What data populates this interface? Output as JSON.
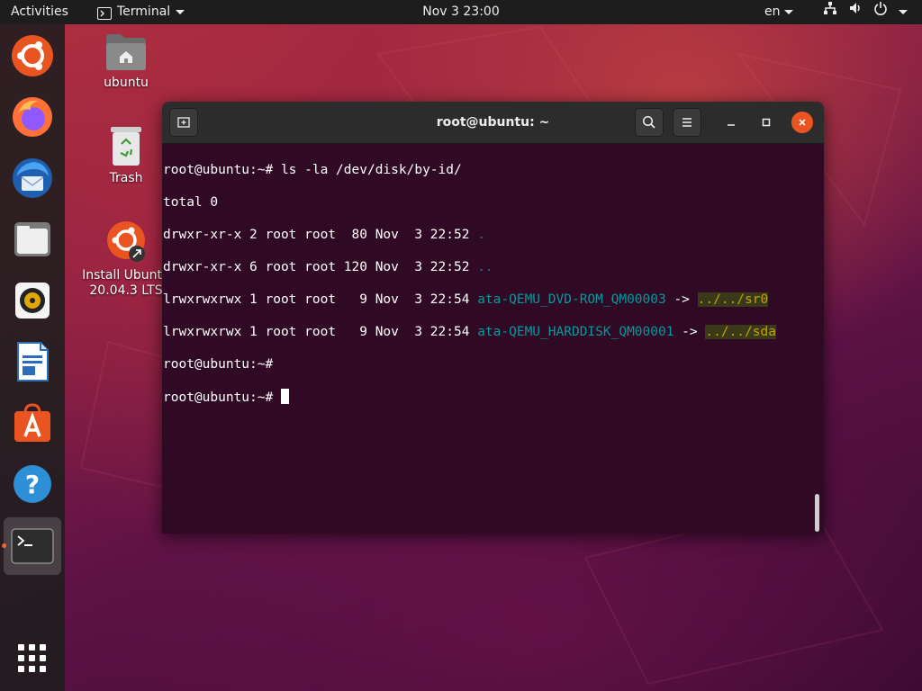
{
  "topbar": {
    "activities": "Activities",
    "app_name": "Terminal",
    "clock": "Nov 3  23:00",
    "language": "en"
  },
  "dock": {
    "items": [
      {
        "name": "Install Ubuntu"
      },
      {
        "name": "Firefox"
      },
      {
        "name": "Thunderbird"
      },
      {
        "name": "Files"
      },
      {
        "name": "Rhythmbox"
      },
      {
        "name": "LibreOffice Writer"
      },
      {
        "name": "Ubuntu Software"
      },
      {
        "name": "Help"
      },
      {
        "name": "Terminal"
      },
      {
        "name": "Show Applications"
      }
    ]
  },
  "desktop": {
    "home_label": "ubuntu",
    "trash_label": "Trash",
    "installer_label_line1": "Install Ubuntu",
    "installer_label_line2": "20.04.3 LTS"
  },
  "terminal": {
    "title": "root@ubuntu: ~",
    "lines": {
      "cmd": "root@ubuntu:~# ls -la /dev/disk/by-id/",
      "total": "total 0",
      "row1_meta": "drwxr-xr-x 2 root root  80 Nov  3 22:52 ",
      "row1_name": ".",
      "row2_meta": "drwxr-xr-x 6 root root 120 Nov  3 22:52 ",
      "row2_name": "..",
      "row3_meta": "lrwxrwxrwx 1 root root   9 Nov  3 22:54 ",
      "row3_name": "ata-QEMU_DVD-ROM_QM00003",
      "row3_arrow": " -> ",
      "row3_target": "../../sr0",
      "row4_meta": "lrwxrwxrwx 1 root root   9 Nov  3 22:54 ",
      "row4_name": "ata-QEMU_HARDDISK_QM00001",
      "row4_arrow": " -> ",
      "row4_target": "../../sda",
      "prompt1": "root@ubuntu:~# ",
      "prompt2": "root@ubuntu:~# "
    }
  },
  "colors": {
    "terminal_bg": "#300a24",
    "accent": "#e95420",
    "link_name": "#06989a",
    "link_target": "#c4a000"
  }
}
